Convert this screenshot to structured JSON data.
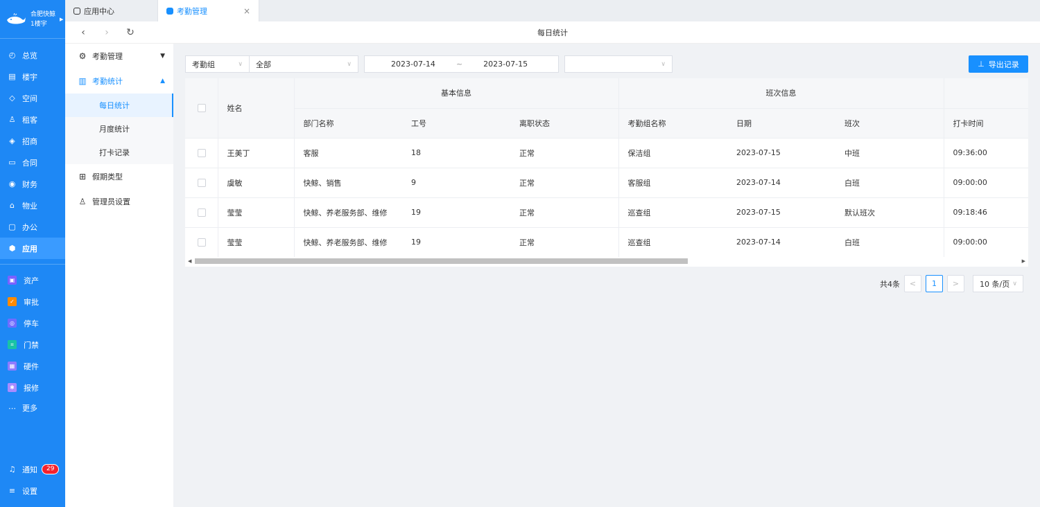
{
  "nav": {
    "brand_line1": "合肥快鲸",
    "brand_line2": "1楼宇",
    "items": [
      {
        "label": "总览",
        "icon": "dashboard-icon"
      },
      {
        "label": "楼宇",
        "icon": "building-icon"
      },
      {
        "label": "空间",
        "icon": "cube-icon"
      },
      {
        "label": "租客",
        "icon": "users-icon"
      },
      {
        "label": "招商",
        "icon": "tag-icon"
      },
      {
        "label": "合同",
        "icon": "document-icon"
      },
      {
        "label": "财务",
        "icon": "money-icon"
      },
      {
        "label": "物业",
        "icon": "home-icon"
      },
      {
        "label": "办公",
        "icon": "monitor-icon"
      },
      {
        "label": "应用",
        "icon": "app-cube-icon"
      }
    ],
    "apps": [
      {
        "label": "资产",
        "icon": "asset-icon",
        "color": "#7b61ff"
      },
      {
        "label": "审批",
        "icon": "approval-icon",
        "color": "#ff8a00"
      },
      {
        "label": "停车",
        "icon": "parking-icon",
        "color": "#6f6cff"
      },
      {
        "label": "门禁",
        "icon": "access-icon",
        "color": "#19c3a6"
      },
      {
        "label": "硬件",
        "icon": "hardware-icon",
        "color": "#8f7bff"
      },
      {
        "label": "报修",
        "icon": "repair-icon",
        "color": "#a98bff"
      }
    ],
    "more": "更多",
    "notify": "通知",
    "notify_count": "29",
    "settings": "设置"
  },
  "tabs": [
    {
      "label": "应用中心"
    },
    {
      "label": "考勤管理"
    }
  ],
  "page_title": "每日统计",
  "submenu": {
    "attendance_mgmt": "考勤管理",
    "attendance_stats": "考勤统计",
    "daily": "每日统计",
    "monthly": "月度统计",
    "clockin": "打卡记录",
    "leave_types": "假期类型",
    "admin_settings": "管理员设置"
  },
  "filters": {
    "group_label": "考勤组",
    "group_value": "全部",
    "date_start": "2023-07-14",
    "date_sep": "~",
    "date_end": "2023-07-15",
    "extra_value": ""
  },
  "export_label": "导出记录",
  "table": {
    "group_basic": "基本信息",
    "group_shift": "班次信息",
    "columns": {
      "name": "姓名",
      "dept": "部门名称",
      "emp_no": "工号",
      "status": "离职状态",
      "group": "考勤组名称",
      "date": "日期",
      "shift": "班次",
      "clock": "打卡时间"
    },
    "rows": [
      {
        "name": "王美丁",
        "dept": "客服",
        "emp_no": "18",
        "status": "正常",
        "group": "保洁组",
        "date": "2023-07-15",
        "shift": "中班",
        "clock": "09:36:00"
      },
      {
        "name": "虞敏",
        "dept": "快鲸、销售",
        "emp_no": "9",
        "status": "正常",
        "group": "客服组",
        "date": "2023-07-14",
        "shift": "白班",
        "clock": "09:00:00"
      },
      {
        "name": "莹莹",
        "dept": "快鲸、养老服务部、维修",
        "emp_no": "19",
        "status": "正常",
        "group": "巡查组",
        "date": "2023-07-15",
        "shift": "默认班次",
        "clock": "09:18:46"
      },
      {
        "name": "莹莹",
        "dept": "快鲸、养老服务部、维修",
        "emp_no": "19",
        "status": "正常",
        "group": "巡查组",
        "date": "2023-07-14",
        "shift": "白班",
        "clock": "09:00:00"
      }
    ]
  },
  "pagination": {
    "total": "共4条",
    "prev": "<",
    "current": "1",
    "next": ">",
    "page_size": "10 条/页"
  }
}
